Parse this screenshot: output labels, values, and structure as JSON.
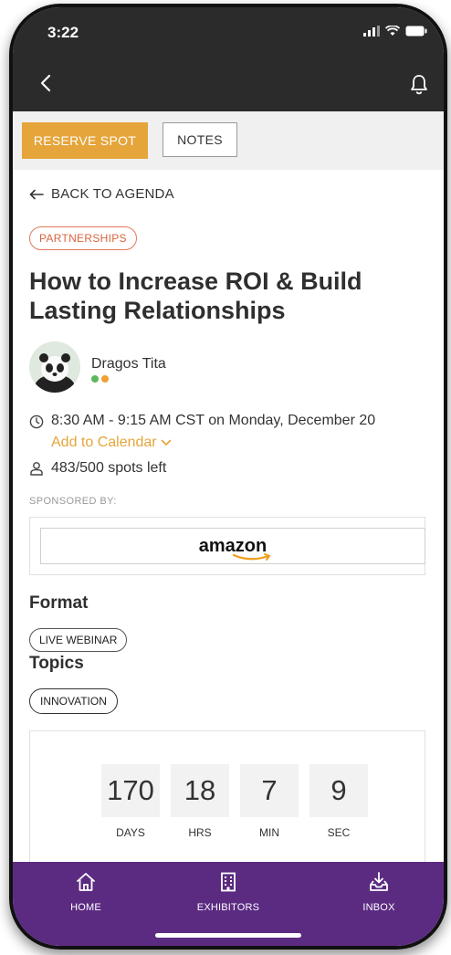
{
  "status": {
    "time": "3:22"
  },
  "actions": {
    "reserve_label": "RESERVE SPOT",
    "notes_label": "NOTES"
  },
  "session": {
    "back_label": "BACK TO AGENDA",
    "category_tag": "PARTNERSHIPS",
    "title": "How to Increase ROI & Build Lasting Relationships",
    "speaker": {
      "name": "Dragos Tita",
      "presence_colors": [
        "#5cb85c",
        "#f0a030"
      ]
    },
    "time": "8:30 AM - 9:15 AM CST on Monday, December 20",
    "add_to_calendar": "Add to Calendar",
    "spots_left": "483/500 spots left",
    "sponsored_by_label": "SPONSORED BY:",
    "sponsor_logo_text": "amazon",
    "format_heading": "Format",
    "format_tag": "LIVE WEBINAR",
    "topics_heading": "Topics",
    "topic_tag": "INNOVATION"
  },
  "countdown": {
    "days": "170",
    "days_label": "DAYS",
    "hrs": "18",
    "hrs_label": "HRS",
    "min": "7",
    "min_label": "MIN",
    "sec": "9",
    "sec_label": "SEC"
  },
  "tabbar": {
    "home_label": "HOME",
    "exhibitors_label": "EXHIBITORS",
    "inbox_label": "INBOX"
  },
  "colors": {
    "accent": "#e5a53a",
    "tabbar": "#5b2b82",
    "tag_partner": "#d9643f"
  },
  "icons": [
    "back-icon",
    "bell-icon",
    "arrow-left-icon",
    "clock-icon",
    "chevron-down-icon",
    "person-icon",
    "home-icon",
    "building-icon",
    "inbox-icon"
  ]
}
